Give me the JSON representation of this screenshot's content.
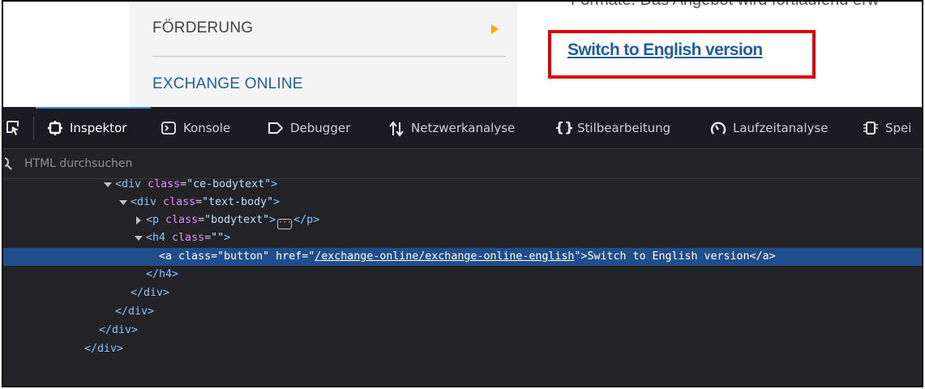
{
  "webpage": {
    "cut_off_text": "Formate. Das Angebot wird fortlaufend erw",
    "menu_items": [
      {
        "label": "FÖRDERUNG"
      },
      {
        "label": "EXCHANGE ONLINE"
      }
    ],
    "english_link": "Switch to English version",
    "colors": {
      "highlight": "#e00000",
      "link": "#1f5f9e",
      "menu_arrow": "#f2a900"
    }
  },
  "devtools": {
    "tabs": [
      {
        "label": "Inspektor",
        "icon": "inspector-icon",
        "active": true
      },
      {
        "label": "Konsole",
        "icon": "console-icon"
      },
      {
        "label": "Debugger",
        "icon": "debugger-icon"
      },
      {
        "label": "Netzwerkanalyse",
        "icon": "network-icon"
      },
      {
        "label": "Stilbearbeitung",
        "icon": "style-editor-icon"
      },
      {
        "label": "Laufzeitanalyse",
        "icon": "performance-icon"
      },
      {
        "label": "Spei",
        "icon": "storage-icon"
      }
    ],
    "search_placeholder": "HTML durchsuchen",
    "tree": [
      {
        "open": "<",
        "tag": "div",
        "attr": "class",
        "val": "\"ce-bodytext\"",
        "close": ">"
      },
      {
        "open": "<",
        "tag": "div",
        "attr": "class",
        "val": "\"text-body\"",
        "close": ">"
      },
      {
        "open": "<",
        "tag": "p",
        "attr": "class",
        "val": "\"bodytext\"",
        "close": ">",
        "end": "</p>"
      },
      {
        "open": "<",
        "tag": "h4",
        "attr": "class",
        "val": "\"\"",
        "close": ">"
      },
      {
        "open": "<",
        "tag": "a",
        "attr1": "class",
        "val1": "\"button\"",
        "attr2": "href",
        "href_quote_open": "=\"",
        "href": "/exchange-online/exchange-online-english",
        "href_quote_close": "\">",
        "text": "Switch to English version",
        "end": "</a>"
      },
      {
        "text": "</h4>"
      },
      {
        "text": "</div>"
      },
      {
        "text": "</div>"
      },
      {
        "text": "</div>"
      },
      {
        "text": "</div>"
      }
    ],
    "colors": {
      "background": "#232327",
      "selection": "#1f4e8a",
      "tag": "#86c5ff",
      "attr": "#e58bff",
      "accent": "#3b8bf0"
    }
  }
}
